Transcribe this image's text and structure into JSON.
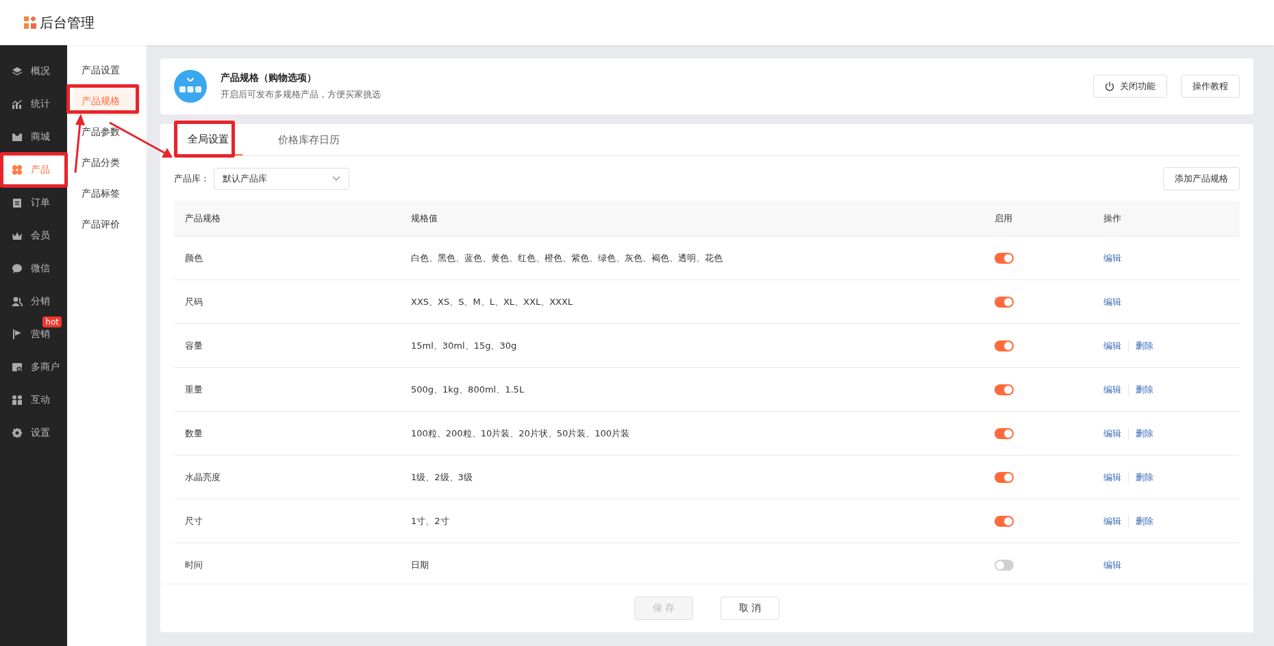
{
  "app": {
    "title": "后台管理"
  },
  "sidebar": {
    "items": [
      {
        "label": "概况",
        "selected": false
      },
      {
        "label": "统计",
        "selected": false
      },
      {
        "label": "商城",
        "selected": false
      },
      {
        "label": "产品",
        "selected": true
      },
      {
        "label": "订单",
        "selected": false
      },
      {
        "label": "会员",
        "selected": false
      },
      {
        "label": "微信",
        "selected": false
      },
      {
        "label": "分销",
        "selected": false
      },
      {
        "label": "营销",
        "selected": false,
        "badge": "hot"
      },
      {
        "label": "多商户",
        "selected": false
      },
      {
        "label": "互动",
        "selected": false
      },
      {
        "label": "设置",
        "selected": false
      }
    ]
  },
  "submenu": {
    "items": [
      {
        "label": "产品设置",
        "selected": false
      },
      {
        "label": "产品规格",
        "selected": true
      },
      {
        "label": "产品参数",
        "selected": false
      },
      {
        "label": "产品分类",
        "selected": false
      },
      {
        "label": "产品标签",
        "selected": false
      },
      {
        "label": "产品评价",
        "selected": false
      }
    ]
  },
  "feature": {
    "title": "产品规格（购物选项）",
    "description": "开启后可发布多规格产品，方便买家挑选",
    "buttons": [
      {
        "label": "关闭功能",
        "kind": "power"
      },
      {
        "label": "操作教程",
        "kind": "plain"
      }
    ]
  },
  "tabs": [
    {
      "label": "全局设置",
      "selected": true
    },
    {
      "label": "价格库存日历",
      "selected": false
    }
  ],
  "filter": {
    "label": "产品库：",
    "value": "默认产品库",
    "add_button": "添加产品规格"
  },
  "table": {
    "columns": [
      "产品规格",
      "规格值",
      "启用",
      "操作"
    ],
    "rows": [
      {
        "name": "颜色",
        "values": "白色、黑色、蓝色、黄色、红色、橙色、紫色、绿色、灰色、褐色、透明、花色",
        "enabled": true,
        "actions": [
          "编辑"
        ]
      },
      {
        "name": "尺码",
        "values": "XXS、XS、S、M、L、XL、XXL、XXXL",
        "enabled": true,
        "actions": [
          "编辑"
        ]
      },
      {
        "name": "容量",
        "values": "15ml、30ml、15g、30g",
        "enabled": true,
        "actions": [
          "编辑",
          "删除"
        ]
      },
      {
        "name": "重量",
        "values": "500g、1kg、800ml、1.5L",
        "enabled": true,
        "actions": [
          "编辑",
          "删除"
        ]
      },
      {
        "name": "数量",
        "values": "100粒、200粒、10片装、20片状、50片装、100片装",
        "enabled": true,
        "actions": [
          "编辑",
          "删除"
        ]
      },
      {
        "name": "水晶亮度",
        "values": "1级、2级、3级",
        "enabled": true,
        "actions": [
          "编辑",
          "删除"
        ]
      },
      {
        "name": "尺寸",
        "values": "1寸、2寸",
        "enabled": true,
        "actions": [
          "编辑",
          "删除"
        ]
      },
      {
        "name": "时间",
        "values": "日期",
        "enabled": false,
        "actions": [
          "编辑"
        ]
      }
    ]
  },
  "footer": {
    "buttons": [
      {
        "label": "保 存",
        "disabled": true
      },
      {
        "label": "取 消",
        "disabled": false
      }
    ]
  }
}
